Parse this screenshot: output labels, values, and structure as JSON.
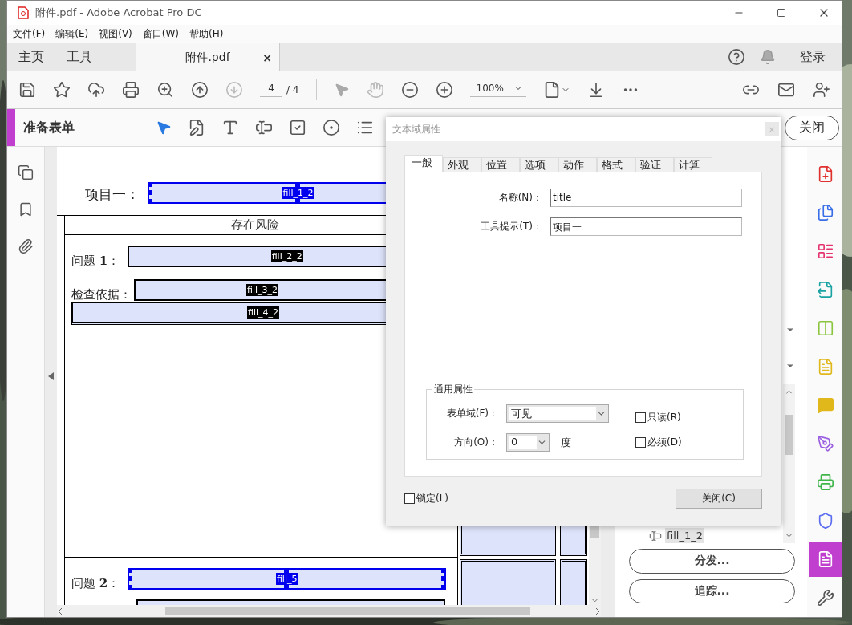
{
  "window": {
    "title": "附件.pdf - Adobe Acrobat Pro DC"
  },
  "menu": [
    "文件(F)",
    "编辑(E)",
    "视图(V)",
    "窗口(W)",
    "帮助(H)"
  ],
  "nav_tabs": [
    {
      "label": "主页",
      "selected": false
    },
    {
      "label": "工具",
      "selected": false
    }
  ],
  "document_tab": {
    "label": "附件.pdf",
    "close": "×",
    "selected": true
  },
  "sign_in": "登录",
  "toolbar": {
    "page": "4",
    "page_total": "/ 4",
    "zoom": "100%"
  },
  "form_bar": {
    "title": "准备表单",
    "close": "关闭"
  },
  "document": {
    "title_label": "项目一：",
    "title_field": {
      "name": "fill_1_2",
      "selected": true
    },
    "section_header": "存在风险",
    "block_1": [
      {
        "kind": "labeled",
        "label": "问题 **1**：",
        "name": "fill_2_2",
        "selected": false
      },
      {
        "kind": "labeled",
        "label": "检查依据：",
        "name": "fill_3_2",
        "selected": false
      },
      {
        "kind": "full",
        "name": "fill_4_2",
        "selected": false
      }
    ],
    "block_2": [
      {
        "kind": "labeled",
        "label": "问题 **2**：",
        "name": "fill_5",
        "selected": true
      },
      {
        "kind": "blank",
        "selected": false
      }
    ]
  },
  "fields_panel": {
    "items": [
      {
        "name": "fill_1_2",
        "selected": true
      }
    ],
    "buttons": [
      "分发...",
      "追踪..."
    ]
  },
  "tool_rail": [
    {
      "selected": false
    },
    {
      "selected": false
    },
    {
      "selected": false
    },
    {
      "selected": false
    },
    {
      "selected": false
    },
    {
      "selected": false
    },
    {
      "selected": false
    },
    {
      "selected": false
    },
    {
      "selected": false
    },
    {
      "selected": false
    },
    {
      "selected": true
    },
    {
      "selected": false
    }
  ],
  "dialog": {
    "title": "文本域属性",
    "close": "×",
    "tabs": [
      {
        "label": "一般",
        "selected": true
      },
      {
        "label": "外观",
        "selected": false
      },
      {
        "label": "位置",
        "selected": false
      },
      {
        "label": "选项",
        "selected": false
      },
      {
        "label": "动作",
        "selected": false
      },
      {
        "label": "格式",
        "selected": false
      },
      {
        "label": "验证",
        "selected": false
      },
      {
        "label": "计算",
        "selected": false
      }
    ],
    "name": {
      "label": "名称(N)：",
      "value": "title"
    },
    "tooltip": {
      "label": "工具提示(T)：",
      "value": "项目一"
    },
    "group": {
      "title": "通用属性",
      "form_field_label": "表单域(F)：",
      "form_field_value": "可见",
      "direction_label": "方向(O)：",
      "direction_value": "0",
      "unit": "度",
      "checks": [
        {
          "label": "只读(R)",
          "checked": false
        },
        {
          "label": "必须(D)",
          "checked": false
        }
      ]
    },
    "lock": {
      "label": "锁定(L)",
      "checked": false
    },
    "button": "关闭(C)"
  }
}
